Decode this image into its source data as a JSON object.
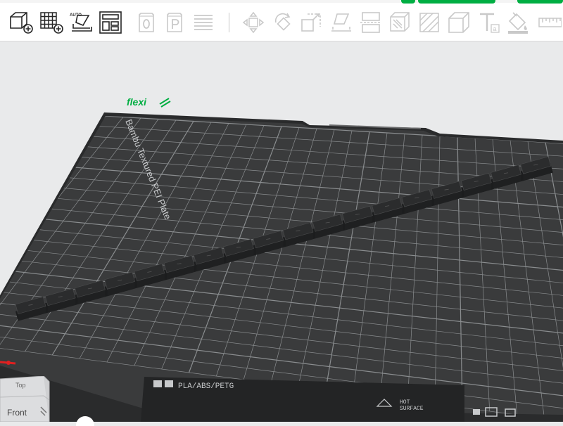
{
  "toolbar": {
    "buttons_left": [
      {
        "name": "add-object-button",
        "icon": "cube-plus-icon"
      },
      {
        "name": "add-plate-button",
        "icon": "grid-plus-icon"
      },
      {
        "name": "auto-orient-button",
        "icon": "auto-orient-icon",
        "badge": "AUTO"
      },
      {
        "name": "arrange-button",
        "icon": "arrange-layout-icon"
      }
    ],
    "buttons_middle": [
      {
        "name": "slice-plate-button",
        "icon": "plate-o-icon",
        "glyph": "O"
      },
      {
        "name": "preview-button",
        "icon": "plate-p-icon",
        "glyph": "P"
      },
      {
        "name": "layers-button",
        "icon": "layers-icon"
      }
    ],
    "buttons_right": [
      {
        "name": "move-tool-button",
        "icon": "move-arrows-icon"
      },
      {
        "name": "rotate-tool-button",
        "icon": "rotate-icon"
      },
      {
        "name": "scale-tool-button",
        "icon": "scale-icon"
      },
      {
        "name": "lay-on-face-button",
        "icon": "lay-on-face-icon"
      },
      {
        "name": "cut-tool-button",
        "icon": "cut-icon"
      },
      {
        "name": "support-paint-button",
        "icon": "support-paint-icon"
      },
      {
        "name": "seam-paint-button",
        "icon": "seam-paint-icon"
      },
      {
        "name": "mesh-boolean-button",
        "icon": "mesh-boolean-icon"
      },
      {
        "name": "text-tool-button",
        "icon": "text-emboss-icon",
        "glyph": "T",
        "sub": "a"
      },
      {
        "name": "color-paint-button",
        "icon": "paint-bucket-icon"
      },
      {
        "name": "measure-button",
        "icon": "ruler-icon"
      }
    ]
  },
  "bed": {
    "logo_text": "flexi",
    "side_text": "Bambu Textured PEI Plate",
    "bottom_label": "PLA/ABS/PETG",
    "hot_label_1": "HOT",
    "hot_label_2": "SURFACE",
    "colors": {
      "plate": "#3a3b3c",
      "grid": "#8a8d8f",
      "frame": "#2a2b2c",
      "model": "#2b2c2d",
      "logo": "#00ae42"
    }
  },
  "view_cube": {
    "top_label": "Top",
    "front_label": "Front"
  }
}
